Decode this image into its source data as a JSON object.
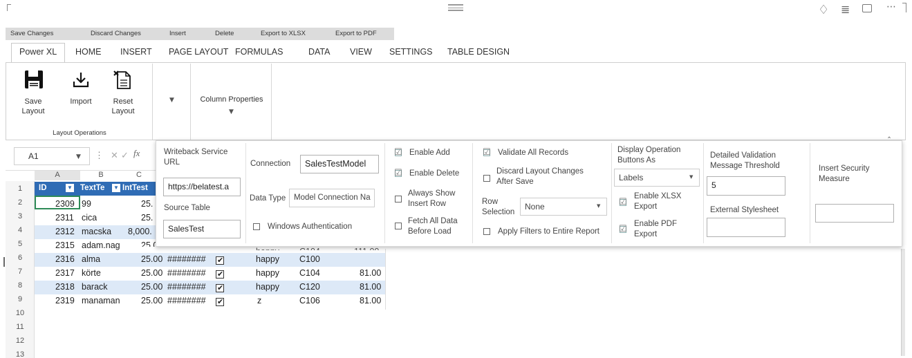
{
  "top_icons": {
    "pin": "pin-icon",
    "filter": "filter-icon",
    "focus": "focus-mode-icon",
    "more": "more-options-icon"
  },
  "actions": [
    "Save Changes",
    "Discard Changes",
    "Insert",
    "Delete",
    "Export to XLSX",
    "Export to PDF"
  ],
  "tabs": [
    "Power XL",
    "HOME",
    "INSERT",
    "PAGE LAYOUT",
    "FORMULAS",
    "DATA",
    "VIEW",
    "SETTINGS",
    "TABLE DESIGN"
  ],
  "ribbon": {
    "save_layout": "Save Layout",
    "save_layout_l1": "Save",
    "save_layout_l2": "Layout",
    "import": "Import",
    "reset_l1": "Reset",
    "reset_l2": "Layout",
    "group_label": "Layout Operations",
    "column_properties": "Column Properties"
  },
  "formula": {
    "namebox": "A1",
    "fx": "fx"
  },
  "columns": [
    "A",
    "B",
    "C"
  ],
  "header_row": {
    "id": "ID",
    "text": "TextTe",
    "int": "IntTest"
  },
  "rows": [
    {
      "n": "1"
    },
    {
      "n": "2",
      "a": "2309",
      "b": "99",
      "c": "25."
    },
    {
      "n": "3",
      "a": "2311",
      "b": "cica",
      "c": "25."
    },
    {
      "n": "4",
      "a": "2312",
      "b": "macska",
      "c": "8,000."
    },
    {
      "n": "5",
      "a": "2315",
      "b": "adam.nag",
      "c": "25.00",
      "e": "happy",
      "f": "C104",
      "g": "111.00"
    },
    {
      "n": "6",
      "a": "2316",
      "b": "alma",
      "c": "25.00",
      "d": "########",
      "e": "happy",
      "f": "C100",
      "g": ""
    },
    {
      "n": "7",
      "a": "2317",
      "b": "körte",
      "c": "25.00",
      "d": "########",
      "e": "happy",
      "f": "C104",
      "g": "81.00"
    },
    {
      "n": "8",
      "a": "2318",
      "b": "barack",
      "c": "25.00",
      "d": "########",
      "e": "happy",
      "f": "C120",
      "g": "81.00"
    },
    {
      "n": "9",
      "a": "2319",
      "b": "manaman",
      "c": "25.00",
      "d": "########",
      "e": "z",
      "f": "C106",
      "g": "81.00"
    },
    {
      "n": "10"
    },
    {
      "n": "11"
    },
    {
      "n": "12"
    },
    {
      "n": "13"
    }
  ],
  "panel": {
    "writeback_label": "Writeback Service URL",
    "writeback_l1": "Writeback Service",
    "writeback_l2": "URL",
    "writeback_value": "https://belatest.a",
    "source_table_label": "Source Table",
    "source_table_value": "SalesTest",
    "connection_label": "Connection",
    "connection_value": "SalesTestModel",
    "data_type_label": "Data Type",
    "data_type_value": "Model Connection Na",
    "windows_auth": "Windows Authentication",
    "enable_add": "Enable Add",
    "enable_delete": "Enable Delete",
    "always_show_l1": "Always Show",
    "always_show_l2": "Insert Row",
    "fetch_all_l1": "Fetch All Data",
    "fetch_all_l2": "Before Load",
    "validate_all": "Validate All Records",
    "discard_l1": "Discard Layout Changes",
    "discard_l2": "After Save",
    "row_sel_l1": "Row",
    "row_sel_l2": "Selection",
    "row_sel_value": "None",
    "apply_filters": "Apply Filters to Entire Report",
    "display_ops_l1": "Display Operation",
    "display_ops_l2": "Buttons As",
    "display_ops_value": "Labels",
    "xlsx_l1": "Enable XLSX",
    "xlsx_l2": "Export",
    "pdf_l1": "Enable PDF",
    "pdf_l2": "Export",
    "detailed_l1": "Detailed Validation",
    "detailed_l2": "Message Threshold",
    "detailed_value": "5",
    "ext_style": "External Stylesheet",
    "ext_style_value": "",
    "insert_sec_l1": "Insert Security",
    "insert_sec_l2": "Measure",
    "insert_sec_value": ""
  }
}
